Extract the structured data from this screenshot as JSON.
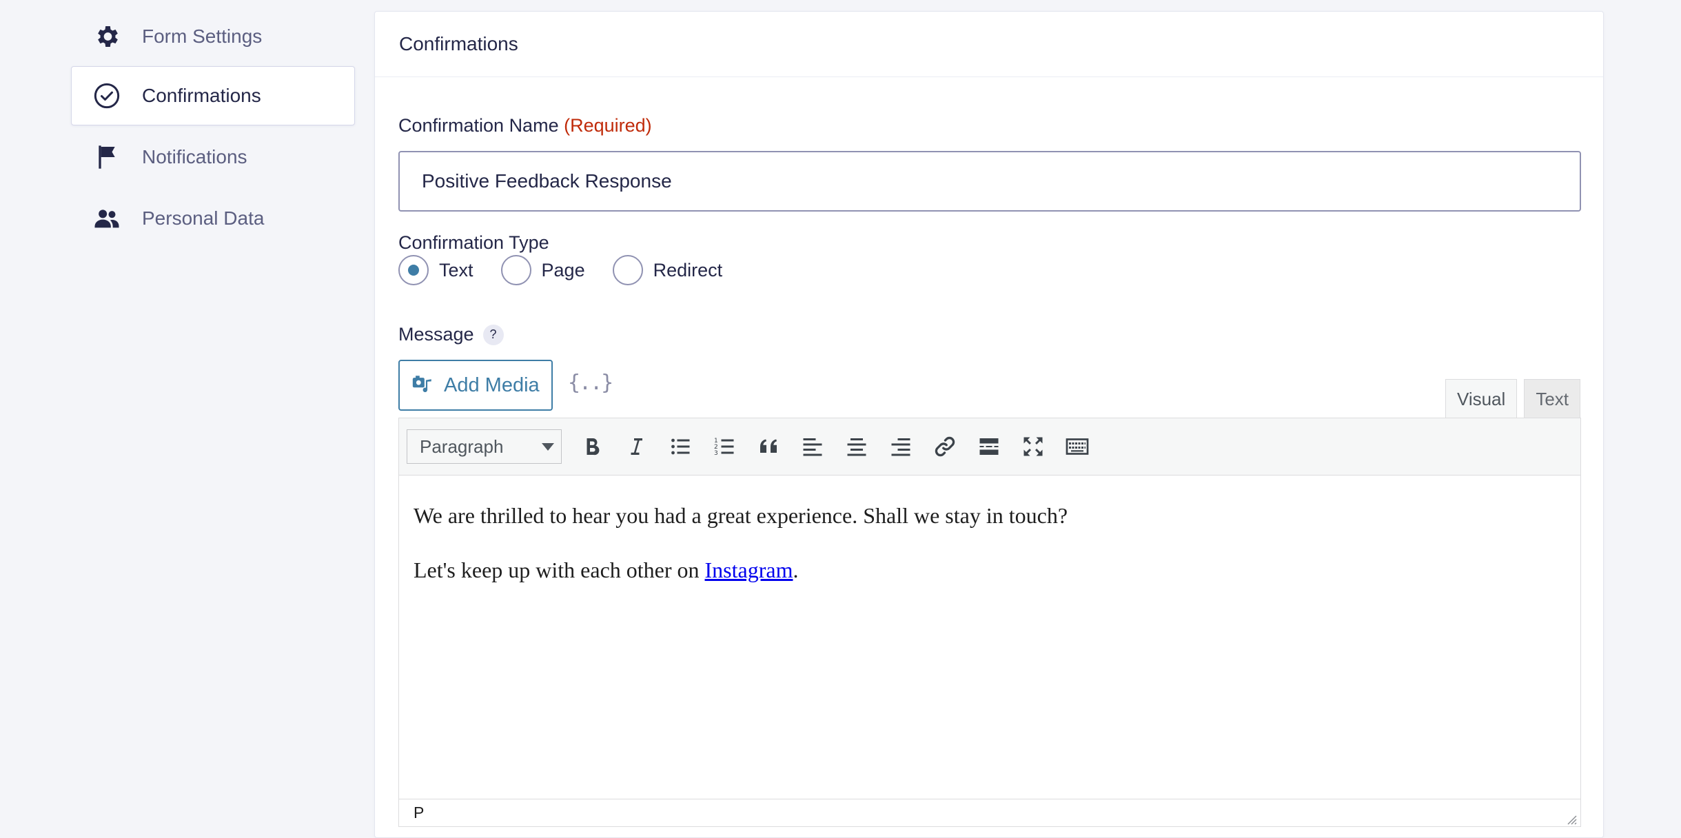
{
  "sidebar": {
    "items": [
      {
        "label": "Form Settings",
        "icon": "gear-icon"
      },
      {
        "label": "Confirmations",
        "icon": "check-circle-icon",
        "active": true
      },
      {
        "label": "Notifications",
        "icon": "flag-icon"
      },
      {
        "label": "Personal Data",
        "icon": "users-icon"
      }
    ]
  },
  "panel": {
    "title": "Confirmations",
    "name_label": "Confirmation Name",
    "required_text": "(Required)",
    "name_value": "Positive Feedback Response",
    "type_label": "Confirmation Type",
    "type_options": [
      "Text",
      "Page",
      "Redirect"
    ],
    "type_selected": "Text",
    "message_label": "Message",
    "help_text": "?",
    "add_media_label": "Add Media",
    "merge_tags_label": "{..}"
  },
  "editor": {
    "tabs": [
      "Visual",
      "Text"
    ],
    "active_tab": "Visual",
    "format_value": "Paragraph",
    "toolbar_buttons": [
      "bold-icon",
      "italic-icon",
      "bullet-list-icon",
      "numbered-list-icon",
      "blockquote-icon",
      "align-left-icon",
      "align-center-icon",
      "align-right-icon",
      "link-icon",
      "read-more-icon",
      "fullscreen-icon",
      "toolbar-toggle-icon"
    ],
    "paragraph1": "We are thrilled to hear you had a great experience. Shall we stay in touch?",
    "paragraph2_prefix": "Let's keep up with each other on ",
    "paragraph2_link": "Instagram",
    "paragraph2_suffix": ".",
    "status_path": "P"
  },
  "colors": {
    "accent": "#3e7da6",
    "required": "#c02b0a",
    "text": "#242748",
    "muted": "#5b5e80",
    "link": "#0000ee",
    "background": "#f4f5f9"
  }
}
